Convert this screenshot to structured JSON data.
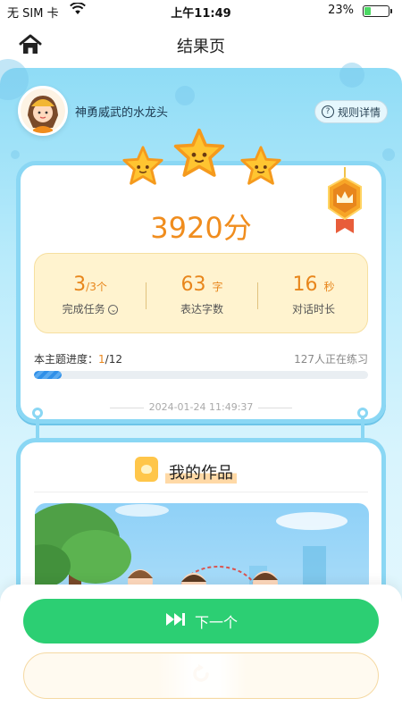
{
  "status_bar": {
    "carrier": "无 SIM 卡",
    "time": "上午11:49",
    "battery": "23%",
    "battery_level": 0.23
  },
  "navbar": {
    "title": "结果页",
    "home_icon": "home-icon"
  },
  "user": {
    "name": "神勇威武的水龙头",
    "avatar_icon": "avatar-girl-icon"
  },
  "rules_button": {
    "label": "规则详情",
    "icon": "question-circle-icon"
  },
  "result": {
    "stars": 3,
    "score": "3920分",
    "medal_icon": "crown-medal-icon",
    "stats": [
      {
        "value": "3",
        "unit": "/3个",
        "label": "完成任务",
        "has_chevron": true
      },
      {
        "value": "63",
        "unit": "字",
        "label": "表达字数"
      },
      {
        "value": "16",
        "unit": "秒",
        "label": "对话时长"
      }
    ],
    "progress": {
      "label": "本主题进度：",
      "current": "1",
      "total": "/12",
      "fraction": 0.0833,
      "practicing": "127人正在练习"
    },
    "date": "2024-01-24 11:49:37"
  },
  "works": {
    "title": "我的作品",
    "icon": "photo-frame-icon",
    "image_icon": "park-jump-rope-illustration"
  },
  "actions": {
    "next_label": "下一个",
    "next_icon": "skip-next-icon",
    "retry_icon": "retry-arrow-icon"
  },
  "colors": {
    "accent_orange": "#f08d1e",
    "card_border": "#8ad7f4",
    "stats_bg": "#fff3cf",
    "next_green": "#2ccf73",
    "progress_blue": "#2f8fe8"
  }
}
